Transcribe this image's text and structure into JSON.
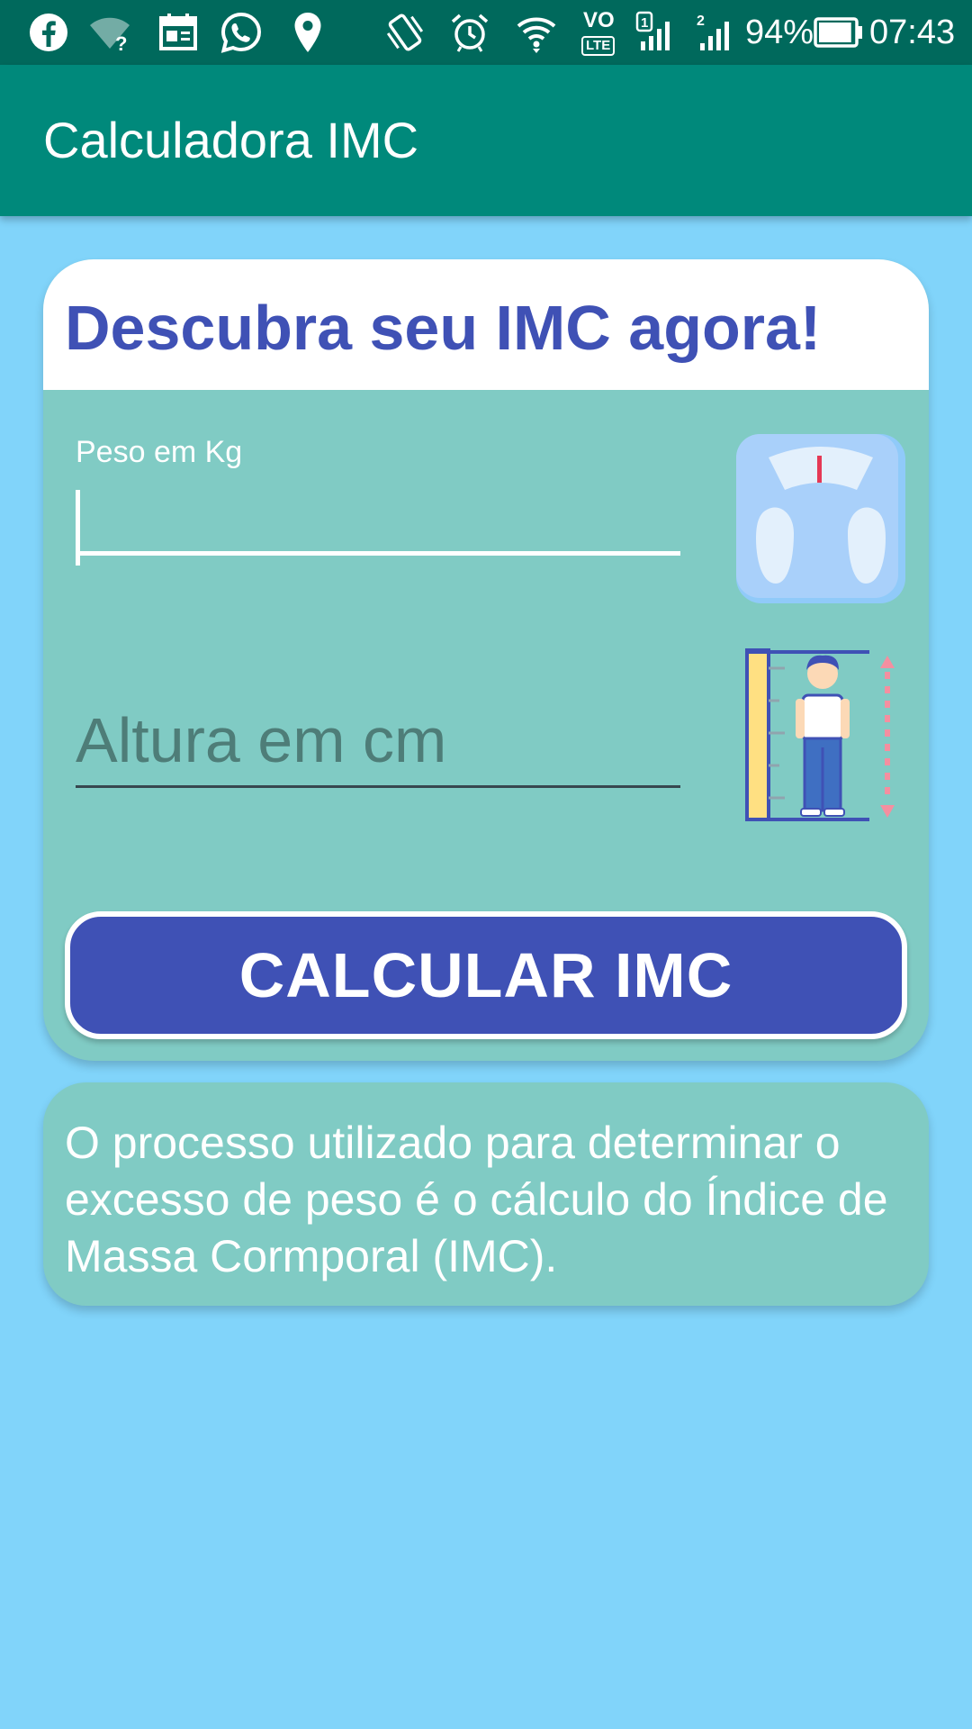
{
  "status_bar": {
    "battery_percent": "94%",
    "battery_level": 0.94,
    "time": "07:43",
    "left_icons": [
      "facebook-icon",
      "wifi-unknown-icon",
      "calendar-icon",
      "whatsapp-icon",
      "location-pin-icon"
    ],
    "right_icons": [
      "vibrate-icon",
      "alarm-icon",
      "wifi-icon",
      "volte-icon",
      "sim1-signal-icon",
      "sim2-signal-icon",
      "battery-icon"
    ],
    "volte_label": "VO",
    "lte_label": "LTE",
    "sim1_label": "1",
    "sim2_label": "2"
  },
  "app_bar": {
    "title": "Calculadora IMC"
  },
  "form_card": {
    "heading": "Descubra seu IMC agora!",
    "weight": {
      "label": "Peso em Kg",
      "value": "",
      "image_icon": "bathroom-scale-icon"
    },
    "height": {
      "placeholder": "Altura em cm",
      "value": "",
      "image_icon": "height-measure-icon"
    },
    "button_label": "CALCULAR IMC"
  },
  "info_card": {
    "text": "O processo utilizado para determinar o excesso de peso é o cálculo do Índice de Massa Cormporal (IMC)."
  },
  "colors": {
    "status_bar": "#00695C",
    "app_bar": "#00897B",
    "background": "#81D4FA",
    "card": "#80CBC4",
    "accent": "#3F51B5"
  }
}
